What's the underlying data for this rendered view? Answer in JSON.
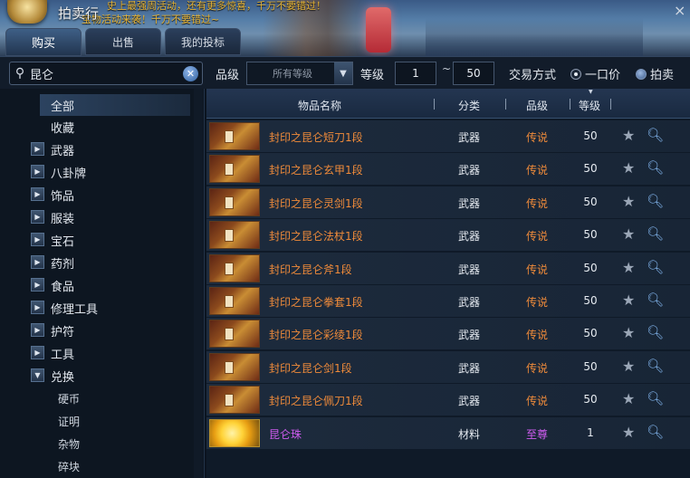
{
  "window": {
    "title": "拍卖行",
    "marquee_line1": "史上最强周活动，还有更多惊喜，千万不要错过！",
    "marquee_line2": "宝物活动来袭！千万不要错过~",
    "close_glyph": "×"
  },
  "tabs": [
    {
      "label": "购买",
      "active": true
    },
    {
      "label": "出售",
      "active": false
    },
    {
      "label": "我的投标",
      "active": false
    }
  ],
  "filters": {
    "search_value": "昆仑",
    "grade_label": "品级",
    "grade_select": "所有等级",
    "level_label": "等级",
    "level_min": "1",
    "level_tilde": "~",
    "level_max": "50",
    "trade_label": "交易方式",
    "trade_options": [
      {
        "label": "一口价",
        "selected": true
      },
      {
        "label": "拍卖",
        "selected": false
      }
    ]
  },
  "sidebar": {
    "categories": [
      {
        "label": "全部",
        "kind": "top",
        "selected": true
      },
      {
        "label": "收藏",
        "kind": "top"
      },
      {
        "label": "武器",
        "kind": "group"
      },
      {
        "label": "八卦牌",
        "kind": "group"
      },
      {
        "label": "饰品",
        "kind": "group"
      },
      {
        "label": "服装",
        "kind": "group"
      },
      {
        "label": "宝石",
        "kind": "group"
      },
      {
        "label": "药剂",
        "kind": "group"
      },
      {
        "label": "食品",
        "kind": "group"
      },
      {
        "label": "修理工具",
        "kind": "group"
      },
      {
        "label": "护符",
        "kind": "group"
      },
      {
        "label": "工具",
        "kind": "group"
      },
      {
        "label": "兑换",
        "kind": "group",
        "expanded": true
      },
      {
        "label": "硬币",
        "kind": "sub"
      },
      {
        "label": "证明",
        "kind": "sub"
      },
      {
        "label": "杂物",
        "kind": "sub"
      },
      {
        "label": "碎块",
        "kind": "sub"
      }
    ]
  },
  "table": {
    "headers": {
      "name": "物品名称",
      "category": "分类",
      "grade": "品级",
      "level": "等级"
    },
    "rows": [
      {
        "name": "封印之昆仑短刀1段",
        "category": "武器",
        "grade": "传说",
        "level": "50",
        "tier": "legend"
      },
      {
        "name": "封印之昆仑玄甲1段",
        "category": "武器",
        "grade": "传说",
        "level": "50",
        "tier": "legend"
      },
      {
        "name": "封印之昆仑灵剑1段",
        "category": "武器",
        "grade": "传说",
        "level": "50",
        "tier": "legend"
      },
      {
        "name": "封印之昆仑法杖1段",
        "category": "武器",
        "grade": "传说",
        "level": "50",
        "tier": "legend"
      },
      {
        "name": "封印之昆仑斧1段",
        "category": "武器",
        "grade": "传说",
        "level": "50",
        "tier": "legend"
      },
      {
        "name": "封印之昆仑拳套1段",
        "category": "武器",
        "grade": "传说",
        "level": "50",
        "tier": "legend"
      },
      {
        "name": "封印之昆仑彩绫1段",
        "category": "武器",
        "grade": "传说",
        "level": "50",
        "tier": "legend"
      },
      {
        "name": "封印之昆仑剑1段",
        "category": "武器",
        "grade": "传说",
        "level": "50",
        "tier": "legend"
      },
      {
        "name": "封印之昆仑佩刀1段",
        "category": "武器",
        "grade": "传说",
        "level": "50",
        "tier": "legend"
      },
      {
        "name": "昆仑珠",
        "category": "材料",
        "grade": "至尊",
        "level": "1",
        "tier": "supreme"
      }
    ]
  },
  "colors": {
    "legend": "#f08b3a",
    "supreme": "#cf5cf0"
  },
  "icons": {
    "search": "search-icon",
    "clear": "clear-icon",
    "favorite": "star-icon",
    "inspect": "magnifier-icon",
    "expand": "triangle-right-icon"
  }
}
